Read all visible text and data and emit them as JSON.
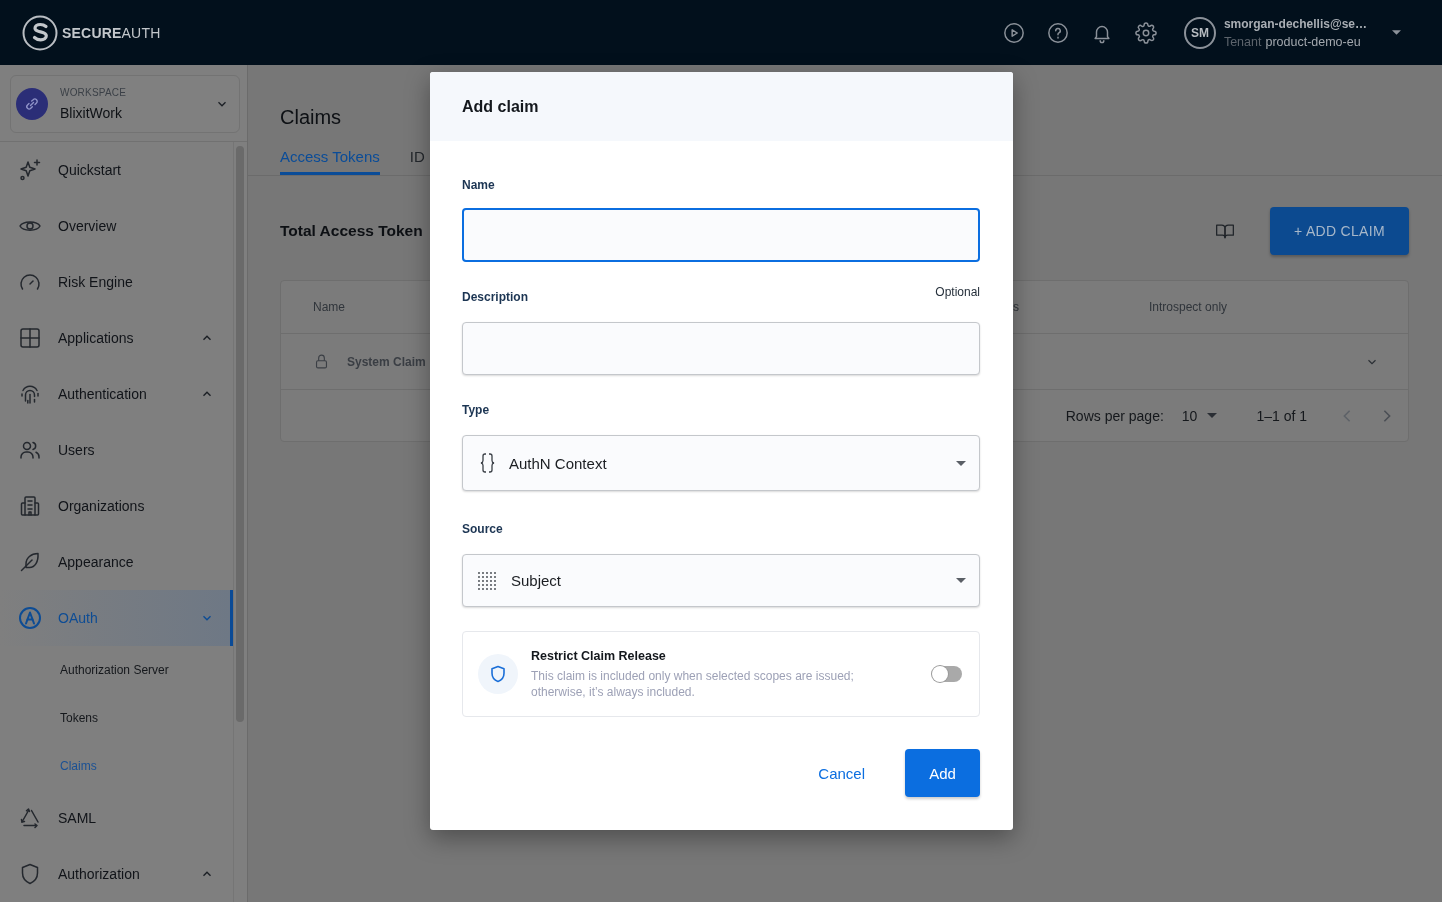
{
  "topbar": {
    "logo": "**SECURE**AUTH",
    "user": {
      "initials": "SM",
      "email": "smorgan-dechellis@se…",
      "tenant_label": "Tenant",
      "tenant": "product-demo-eu"
    }
  },
  "sidebar": {
    "workspace": {
      "label": "WORKSPACE",
      "name": "BlixitWork"
    },
    "items": [
      {
        "label": "Quickstart",
        "selected": false
      },
      {
        "label": "Overview",
        "selected": false
      },
      {
        "label": "Risk Engine",
        "selected": false
      },
      {
        "label": "Applications",
        "selected": false,
        "expanded": false
      },
      {
        "label": "Authentication",
        "selected": false,
        "expanded": false
      },
      {
        "label": "Users",
        "selected": false
      },
      {
        "label": "Organizations",
        "selected": false
      },
      {
        "label": "Appearance",
        "selected": false
      },
      {
        "label": "OAuth",
        "selected": true,
        "expanded": true,
        "children": [
          {
            "label": "Authorization Server",
            "selected": false
          },
          {
            "label": "Tokens",
            "selected": false
          },
          {
            "label": "Claims",
            "selected": true
          }
        ]
      },
      {
        "label": "SAML",
        "selected": false
      },
      {
        "label": "Authorization",
        "selected": false,
        "expanded": false
      }
    ]
  },
  "main": {
    "title": "Claims",
    "tabs": [
      {
        "label": "Access Tokens",
        "selected": true
      },
      {
        "label": "ID",
        "selected": false
      }
    ],
    "section_title": "Total Access Token",
    "add_button": "+ ADD CLAIM",
    "table": {
      "columns": [
        "Name",
        "s",
        "Introspect only"
      ],
      "rows": [
        {
          "name": "System Claim"
        }
      ],
      "footer": {
        "rows_per_page_label": "Rows per page:",
        "rows_per_page": "10",
        "range": "1–1 of 1"
      }
    }
  },
  "dialog": {
    "title": "Add claim",
    "fields": [
      {
        "kind": "text",
        "label": "Name",
        "focused": true
      },
      {
        "kind": "text",
        "label": "Description",
        "note": "Optional",
        "focused": false
      },
      {
        "kind": "select",
        "label": "Type",
        "value": "AuthN Context"
      },
      {
        "kind": "select",
        "label": "Source",
        "value": "Subject"
      }
    ],
    "restrict": {
      "title": "Restrict Claim Release",
      "description": "This claim is included only when selected scopes are issued; otherwise, it’s always included.",
      "on": false
    },
    "buttons": {
      "cancel": "Cancel",
      "confirm": "Add"
    }
  }
}
